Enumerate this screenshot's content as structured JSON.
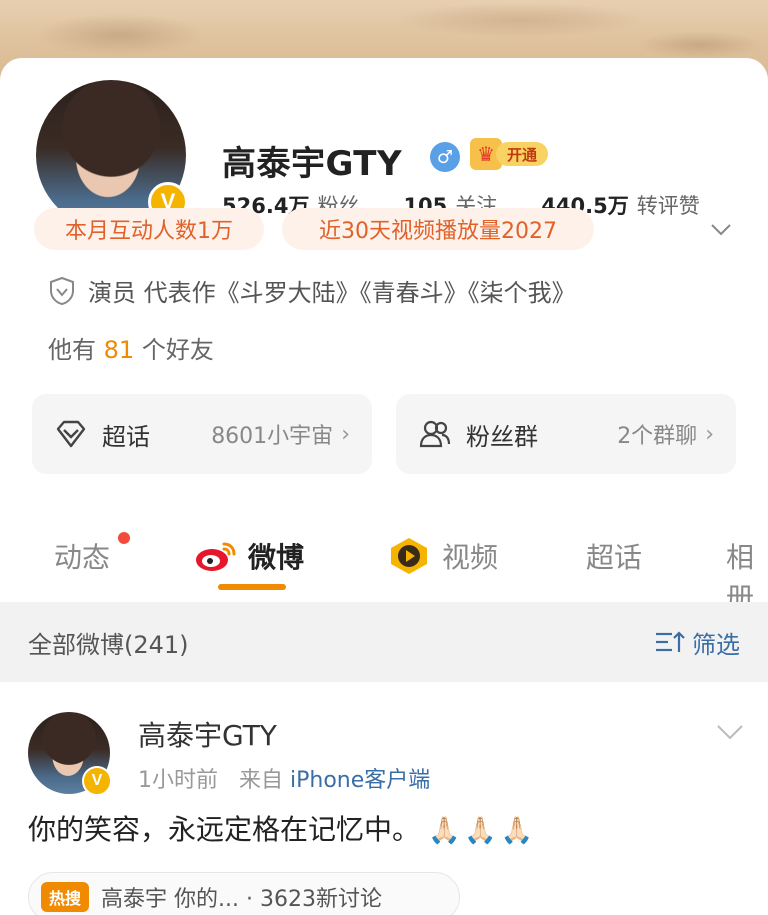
{
  "profile": {
    "name": "高泰宇GTY",
    "gender_symbol": "♂",
    "vip_label": "开通",
    "verified_badge": "V",
    "stats": [
      {
        "value": "526.4万",
        "label": "粉丝"
      },
      {
        "value": "105",
        "label": "关注"
      },
      {
        "value": "440.5万",
        "label": "转评赞"
      }
    ],
    "pills": [
      "本月互动人数1万",
      "近30天视频播放量2027"
    ],
    "cert": "演员 代表作《斗罗大陆》《青春斗》《柒个我》",
    "friends_prefix": "他有",
    "friends_count": "81",
    "friends_suffix": "个好友"
  },
  "shortcuts": [
    {
      "title": "超话",
      "sub": "8601小宇宙"
    },
    {
      "title": "粉丝群",
      "sub": "2个群聊"
    }
  ],
  "tabs": [
    "动态",
    "微博",
    "视频",
    "超话",
    "相册"
  ],
  "filterbar": {
    "count": "全部微博(241)",
    "filter": "筛选"
  },
  "post": {
    "author": "高泰宇GTY",
    "time": "1小时前",
    "from": "来自",
    "source": "iPhone客户端",
    "text": "你的笑容，永远定格在记忆中。",
    "emojis": "🙏🏻🙏🏻🙏🏻",
    "hot_tag": "热搜",
    "hot_text": "高泰宇 你的... · 3623新讨论"
  },
  "colors": {
    "accent": "#f08a00",
    "link": "#3a6ea5",
    "pill_text": "#e0622b",
    "vip": "#f5b400"
  }
}
